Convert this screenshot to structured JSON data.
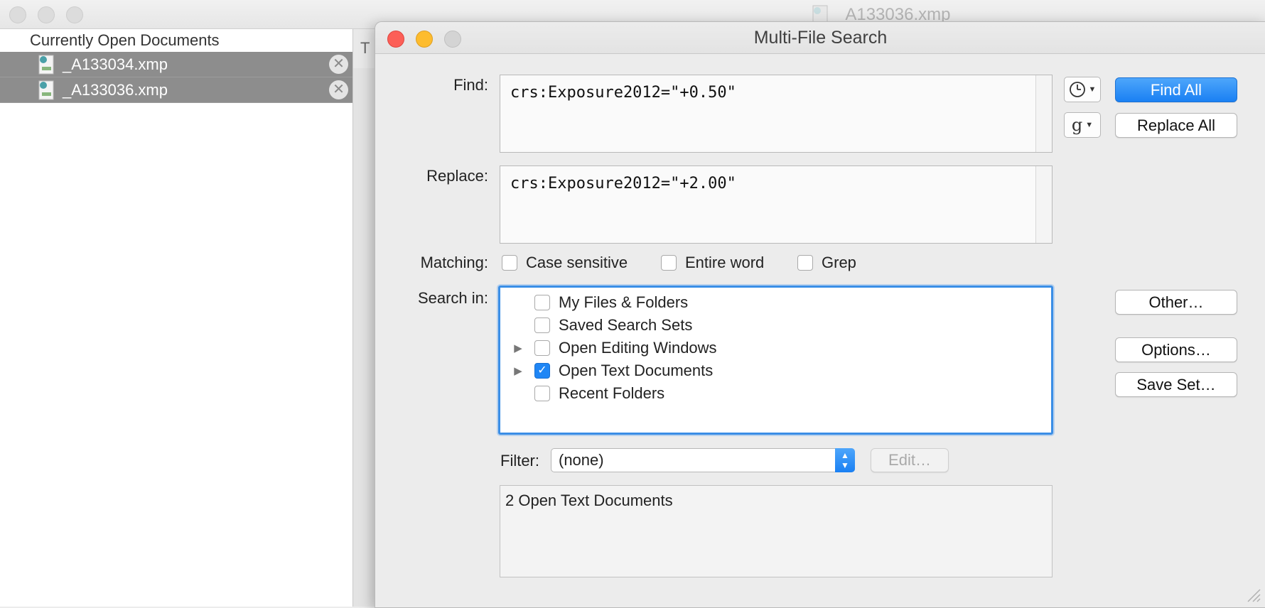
{
  "background_window": {
    "doc_title": "_A133036.xmp",
    "sidebar_header": "Currently Open Documents",
    "open_documents": [
      {
        "name": "_A133034.xmp"
      },
      {
        "name": "_A133036.xmp"
      }
    ],
    "tab_glyph": "T"
  },
  "dialog": {
    "title": "Multi-File Search",
    "find": {
      "label": "Find:",
      "value": "crs:Exposure2012=\"+0.50\""
    },
    "replace": {
      "label": "Replace:",
      "value": "crs:Exposure2012=\"+2.00\""
    },
    "history_icon": "clock-icon",
    "grep_pattern_glyph": "g",
    "buttons": {
      "find_all": "Find All",
      "replace_all": "Replace All",
      "other": "Other…",
      "options": "Options…",
      "save_set": "Save Set…",
      "edit": "Edit…"
    },
    "matching": {
      "label": "Matching:",
      "options": [
        {
          "label": "Case sensitive",
          "checked": false
        },
        {
          "label": "Entire word",
          "checked": false
        },
        {
          "label": "Grep",
          "checked": false
        }
      ]
    },
    "search_in": {
      "label": "Search in:",
      "items": [
        {
          "label": "My Files & Folders",
          "checked": false,
          "expandable": false
        },
        {
          "label": "Saved Search Sets",
          "checked": false,
          "expandable": false
        },
        {
          "label": "Open Editing Windows",
          "checked": false,
          "expandable": true
        },
        {
          "label": "Open Text Documents",
          "checked": true,
          "expandable": true
        },
        {
          "label": "Recent Folders",
          "checked": false,
          "expandable": false
        }
      ]
    },
    "filter": {
      "label": "Filter:",
      "value": "(none)"
    },
    "summary": "2 Open Text Documents"
  },
  "colors": {
    "accent": "#1a80f3",
    "close": "#fc5f57",
    "minimize": "#fdbc2e",
    "selected_row": "#8d8d8d"
  }
}
